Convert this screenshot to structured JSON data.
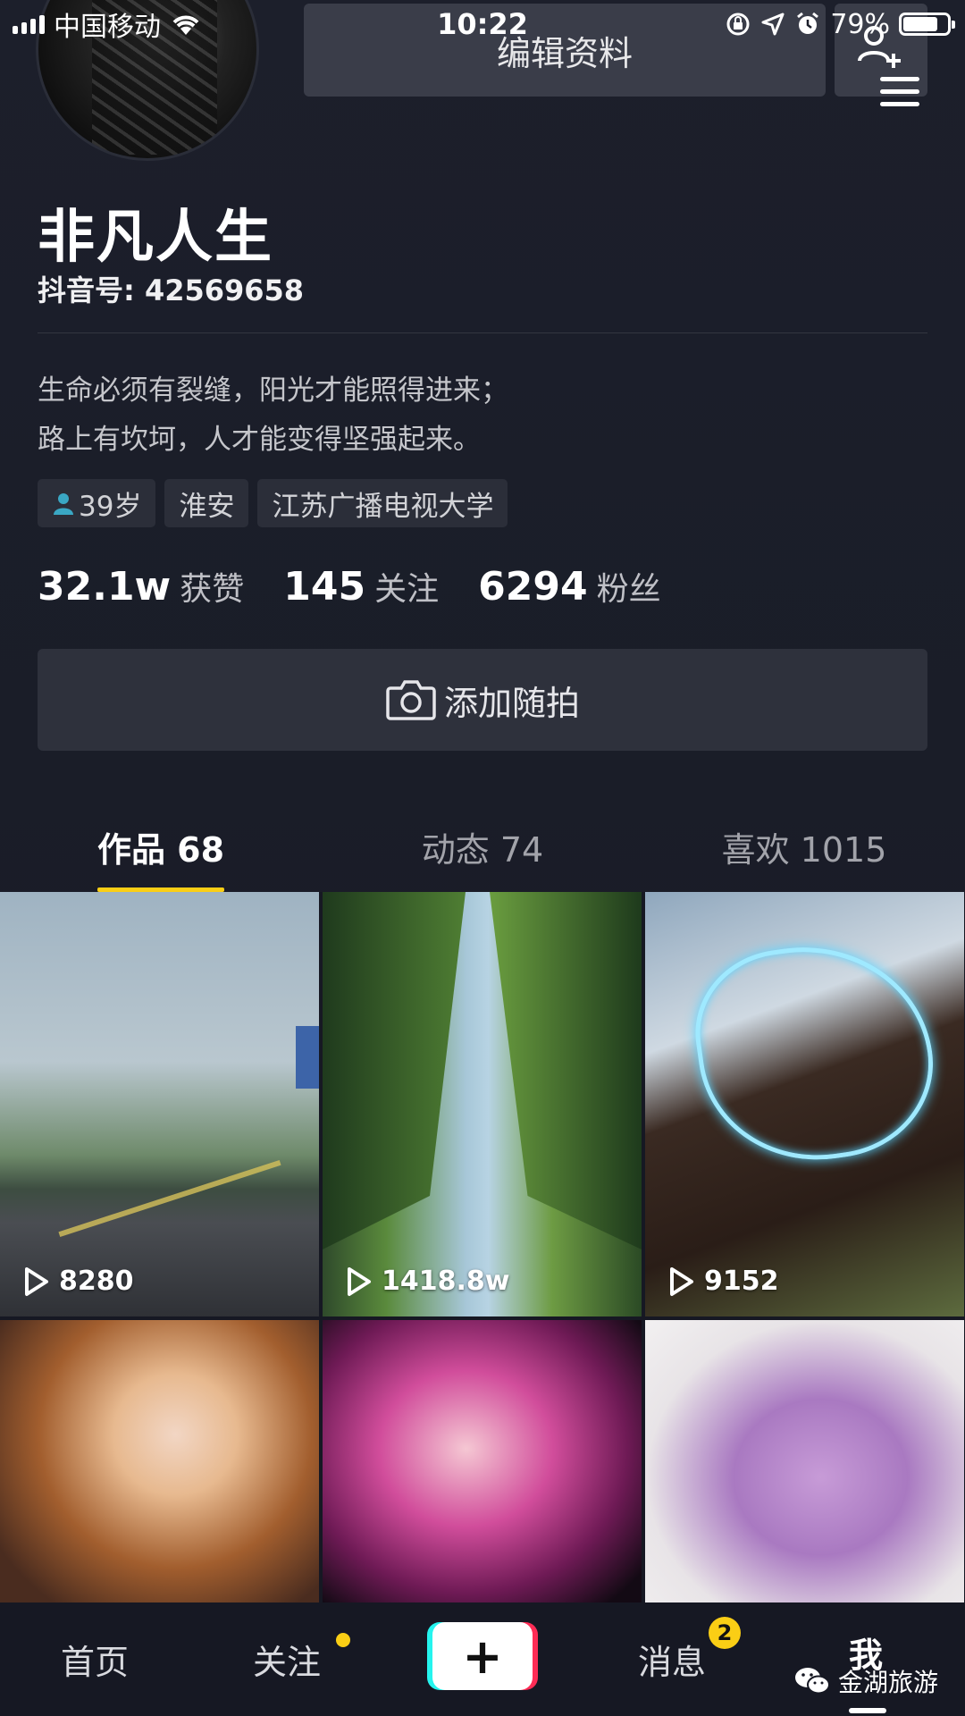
{
  "status_bar": {
    "carrier": "中国移动",
    "time": "10:22",
    "battery": "79%",
    "battery_level": 0.79
  },
  "header": {
    "edit_profile_label": "编辑资料"
  },
  "profile": {
    "nickname": "非凡人生",
    "douyin_id": "抖音号: 42569658",
    "bio_line1": "生命必须有裂缝，阳光才能照得进来；",
    "bio_line2": "路上有坎坷，人才能变得坚强起来。",
    "tags": [
      "39岁",
      "淮安",
      "江苏广播电视大学"
    ]
  },
  "stats": [
    {
      "value": "32.1w",
      "label": "获赞"
    },
    {
      "value": "145",
      "label": "关注"
    },
    {
      "value": "6294",
      "label": "粉丝"
    }
  ],
  "add_snapshot_label": "添加随拍",
  "tabs": [
    "作品 68",
    "动态 74",
    "喜欢 1015"
  ],
  "videos": [
    {
      "plays": "8280"
    },
    {
      "plays": "1418.8w"
    },
    {
      "plays": "9152"
    }
  ],
  "bottom_nav": {
    "home": "首页",
    "following": "关注",
    "plus": "+",
    "messages": "消息",
    "messages_badge": "2",
    "me": "我"
  },
  "watermark": "金湖旅游",
  "colors": {
    "accent_yellow": "#face15",
    "background": "#161823",
    "tiktok_cyan": "#25f4ee",
    "tiktok_red": "#fe2c55"
  }
}
